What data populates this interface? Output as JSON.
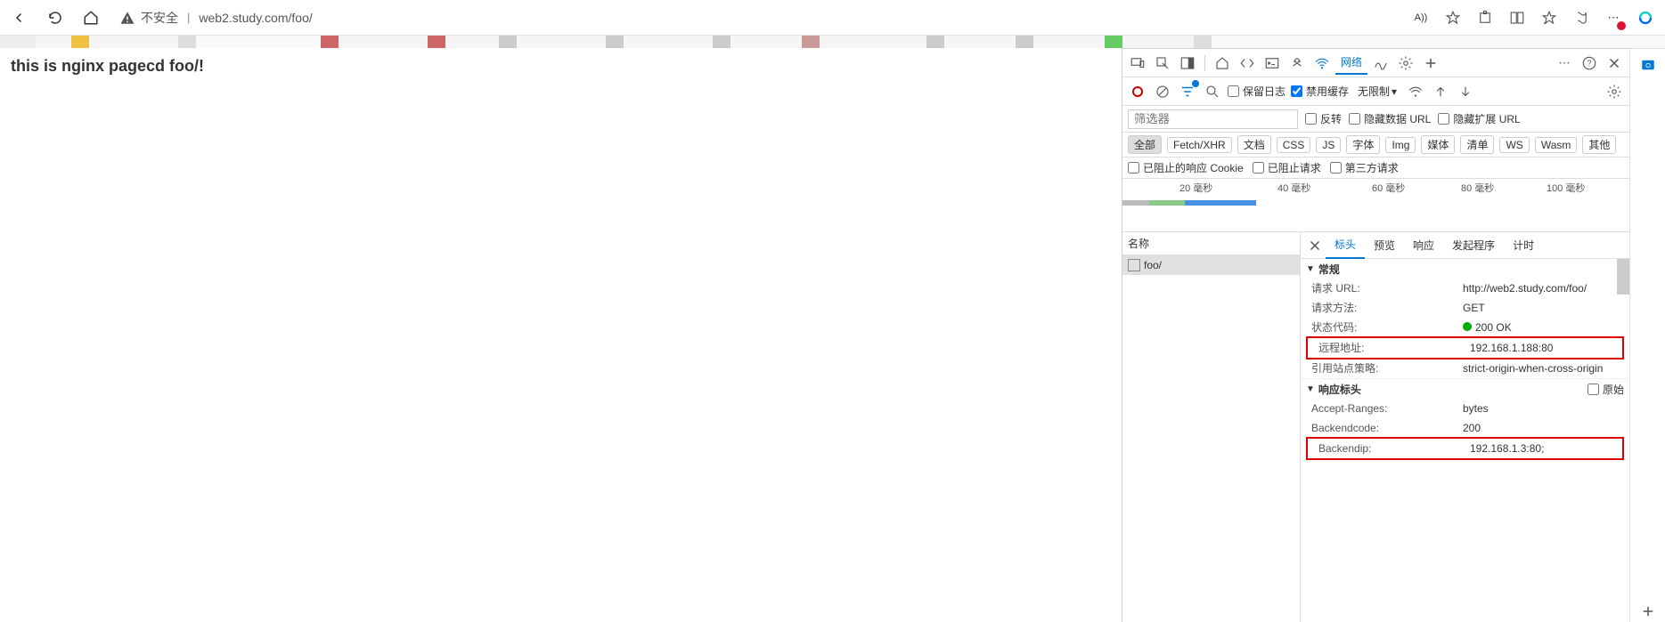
{
  "browser": {
    "insecure": "不安全",
    "url": "web2.study.com/foo/",
    "read_aloud_label": "A))"
  },
  "page": {
    "body_text": "this is nginx pagecd foo/!"
  },
  "devtools": {
    "top": {
      "tab_network": "网络"
    },
    "toolbar": {
      "preserve_log": "保留日志",
      "disable_cache": "禁用缓存",
      "disable_cache_checked": true,
      "throttle": "无限制"
    },
    "filterbar": {
      "filter_placeholder": "筛选器",
      "invert": "反转",
      "hide_data_url": "隐藏数据 URL",
      "hide_ext_url": "隐藏扩展 URL"
    },
    "types": {
      "all": "全部",
      "fetch": "Fetch/XHR",
      "doc": "文档",
      "css": "CSS",
      "js": "JS",
      "font": "字体",
      "img": "Img",
      "media": "媒体",
      "manifest": "清单",
      "ws": "WS",
      "wasm": "Wasm",
      "other": "其他"
    },
    "extra_filters": {
      "blocked_cookies": "已阻止的响应 Cookie",
      "blocked_requests": "已阻止请求",
      "third_party": "第三方请求"
    },
    "timeline": {
      "marks": [
        {
          "pos": 64,
          "label": "20 毫秒"
        },
        {
          "pos": 174,
          "label": "40 毫秒"
        },
        {
          "pos": 280,
          "label": "60 毫秒"
        },
        {
          "pos": 380,
          "label": "80 毫秒"
        },
        {
          "pos": 476,
          "label": "100 毫秒"
        }
      ]
    },
    "list": {
      "header": "名称",
      "rows": [
        {
          "name": "foo/"
        }
      ]
    },
    "detail": {
      "tabs": {
        "headers": "标头",
        "preview": "预览",
        "response": "响应",
        "initiator": "发起程序",
        "timing": "计时"
      },
      "general_title": "常规",
      "general": {
        "request_url_k": "请求 URL:",
        "request_url_v": "http://web2.study.com/foo/",
        "request_method_k": "请求方法:",
        "request_method_v": "GET",
        "status_code_k": "状态代码:",
        "status_code_v": "200 OK",
        "remote_addr_k": "远程地址:",
        "remote_addr_v": "192.168.1.188:80",
        "referrer_policy_k": "引用站点策略:",
        "referrer_policy_v": "strict-origin-when-cross-origin"
      },
      "response_headers_title": "响应标头",
      "raw_label": "原始",
      "response_headers": {
        "accept_ranges_k": "Accept-Ranges:",
        "accept_ranges_v": "bytes",
        "backend_code_k": "Backendcode:",
        "backend_code_v": "200",
        "backend_ip_k": "Backendip:",
        "backend_ip_v": "192.168.1.3:80;"
      }
    }
  }
}
